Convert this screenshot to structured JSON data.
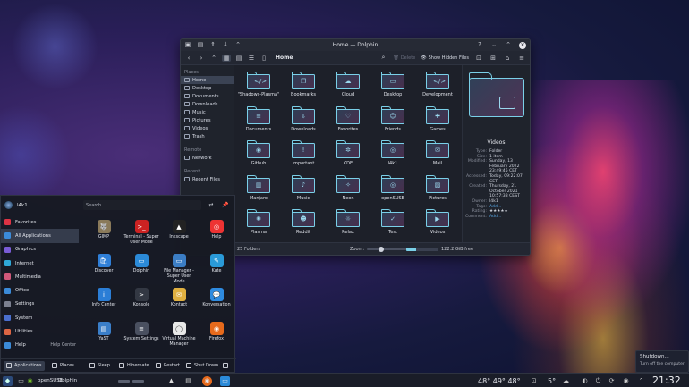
{
  "dolphin": {
    "title": "Home — Dolphin",
    "breadcrumb": "Home",
    "toolbar": {
      "delete_label": "Delete",
      "hidden_label": "Show Hidden Files"
    },
    "places_header": "Places",
    "places": [
      {
        "label": "Home",
        "selected": true
      },
      {
        "label": "Desktop"
      },
      {
        "label": "Documents"
      },
      {
        "label": "Downloads"
      },
      {
        "label": "Music"
      },
      {
        "label": "Pictures"
      },
      {
        "label": "Videos"
      },
      {
        "label": "Trash"
      }
    ],
    "remote_header": "Remote",
    "remote": [
      {
        "label": "Network"
      }
    ],
    "recent_header": "Recent",
    "recent": [
      {
        "label": "Recent Files"
      }
    ],
    "folders": [
      {
        "name": "\"Shadows-Plasma\"",
        "icon": "code-glyph"
      },
      {
        "name": "Bookmarks",
        "icon": "bookmark-glyph"
      },
      {
        "name": "Cloud",
        "icon": "cloud-glyph"
      },
      {
        "name": "Desktop",
        "icon": "desktop-glyph"
      },
      {
        "name": "Development",
        "icon": "code-glyph"
      },
      {
        "name": "Documents",
        "icon": "document-glyph"
      },
      {
        "name": "Downloads",
        "icon": "download-glyph"
      },
      {
        "name": "Favorites",
        "icon": "heart-glyph"
      },
      {
        "name": "Friends",
        "icon": "people-glyph"
      },
      {
        "name": "Games",
        "icon": "gamepad-glyph"
      },
      {
        "name": "Github",
        "icon": "github-glyph"
      },
      {
        "name": "Important",
        "icon": "alert-glyph"
      },
      {
        "name": "KDE",
        "icon": "kde-glyph"
      },
      {
        "name": "l4k1",
        "icon": "suse-glyph"
      },
      {
        "name": "Mail",
        "icon": "mail-glyph"
      },
      {
        "name": "Manjaro",
        "icon": "manjaro-glyph"
      },
      {
        "name": "Music",
        "icon": "music-glyph"
      },
      {
        "name": "Neon",
        "icon": "neon-glyph"
      },
      {
        "name": "openSUSE",
        "icon": "suse-glyph"
      },
      {
        "name": "Pictures",
        "icon": "image-glyph"
      },
      {
        "name": "Plasma",
        "icon": "plasma-glyph"
      },
      {
        "name": "Reddit",
        "icon": "reddit-glyph"
      },
      {
        "name": "Relax",
        "icon": "relax-glyph"
      },
      {
        "name": "Test",
        "icon": "test-glyph"
      },
      {
        "name": "Videos",
        "icon": "video-glyph"
      }
    ],
    "info": {
      "title": "Videos",
      "rows": [
        {
          "k": "Type:",
          "v": "Folder"
        },
        {
          "k": "Size:",
          "v": "1 item"
        },
        {
          "k": "Modified:",
          "v": "Sunday, 13 February 2022 23:49:45 CET"
        },
        {
          "k": "Accessed:",
          "v": "Today, 09:22:07 CET"
        },
        {
          "k": "Created:",
          "v": "Thursday, 21 October 2021 10:57:38 CEST"
        },
        {
          "k": "Owner:",
          "v": "l4k1"
        },
        {
          "k": "Tags:",
          "v": "Add...",
          "link": true
        },
        {
          "k": "Rating:",
          "v": "★★★★★"
        },
        {
          "k": "Comment:",
          "v": "Add...",
          "link": true
        }
      ]
    },
    "status": {
      "count": "25 Folders",
      "zoom_label": "Zoom:",
      "zoom_level": 0.3,
      "free": "122.2 GiB free",
      "used_fraction": 0.3
    }
  },
  "launcher": {
    "user": "l4k1",
    "search_placeholder": "Search...",
    "categories": [
      {
        "label": "Favorites",
        "color": "#d34"
      },
      {
        "label": "All Applications",
        "color": "#3b8bd9",
        "selected": true
      },
      {
        "label": "Graphics",
        "color": "#7a5cd6"
      },
      {
        "label": "Internet",
        "color": "#2fa8d8"
      },
      {
        "label": "Multimedia",
        "color": "#d0587a"
      },
      {
        "label": "Office",
        "color": "#3b8bd9"
      },
      {
        "label": "Settings",
        "color": "#7b8090"
      },
      {
        "label": "System",
        "color": "#4a6fcf"
      },
      {
        "label": "Utilities",
        "color": "#d64"
      },
      {
        "label": "Help",
        "color": "#3b8bd9",
        "extra": "Help Center"
      }
    ],
    "apps": [
      {
        "name": "GIMP",
        "color": "#8a7a5a",
        "glyph": "🐺"
      },
      {
        "name": "Terminal - Super User Mode",
        "color": "#c22",
        "glyph": ">_"
      },
      {
        "name": "Inkscape",
        "color": "#222",
        "glyph": "▲"
      },
      {
        "name": "Help",
        "color": "#e33",
        "glyph": "◎"
      },
      {
        "name": "Discover",
        "color": "#2f7fd8",
        "glyph": "🛍"
      },
      {
        "name": "Dolphin",
        "color": "#2b8ad8",
        "glyph": "▭"
      },
      {
        "name": "File Manager - Super User Mode",
        "color": "#3b7dc4",
        "glyph": "▭"
      },
      {
        "name": "Kate",
        "color": "#2a9ad8",
        "glyph": "✎"
      },
      {
        "name": "Info Center",
        "color": "#2b7ed6",
        "glyph": "i"
      },
      {
        "name": "Konsole",
        "color": "#333843",
        "glyph": ">"
      },
      {
        "name": "Kontact",
        "color": "#e0b040",
        "glyph": "✉"
      },
      {
        "name": "Konversation",
        "color": "#2e8be0",
        "glyph": "💬"
      },
      {
        "name": "YaST",
        "color": "#3a7ec9",
        "glyph": "▤"
      },
      {
        "name": "System Settings",
        "color": "#4a5060",
        "glyph": "≡"
      },
      {
        "name": "Virtual Machine Manager",
        "color": "#e8e8e8",
        "glyph": "◯"
      },
      {
        "name": "Firefox",
        "color": "#e66a1c",
        "glyph": "◉"
      }
    ],
    "footer": {
      "applications": "Applications",
      "places": "Places",
      "sleep": "Sleep",
      "hibernate": "Hibernate",
      "restart": "Restart",
      "shutdown": "Shut Down"
    }
  },
  "notification": {
    "title": "Shutdown...",
    "body": "Turn off the computer"
  },
  "taskbar": {
    "task1": "openSUSE",
    "task2": "Dolphin",
    "weather1": "48° 49° 48°",
    "weather2": "5°",
    "clock": "21:32"
  }
}
